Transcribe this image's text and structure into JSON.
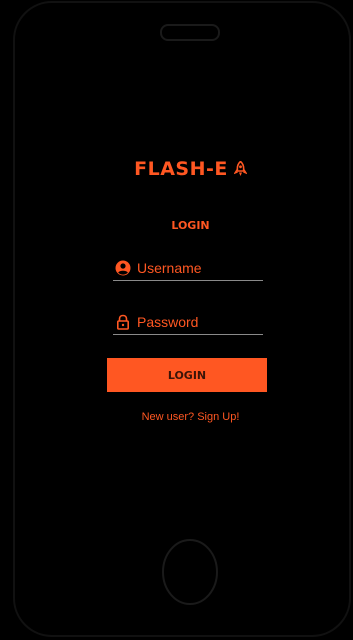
{
  "app": {
    "brand_name": "FLASH-E",
    "brand_icon": "rocket-icon"
  },
  "login": {
    "heading": "LOGIN",
    "username": {
      "placeholder": "Username",
      "value": "",
      "icon": "user-circle-icon"
    },
    "password": {
      "placeholder": "Password",
      "value": "",
      "icon": "lock-icon"
    },
    "button_label": "LOGIN",
    "signup_text": "New user? Sign Up!"
  },
  "colors": {
    "accent": "#ff5722",
    "background": "#000000",
    "divider": "#8a8a8a"
  }
}
